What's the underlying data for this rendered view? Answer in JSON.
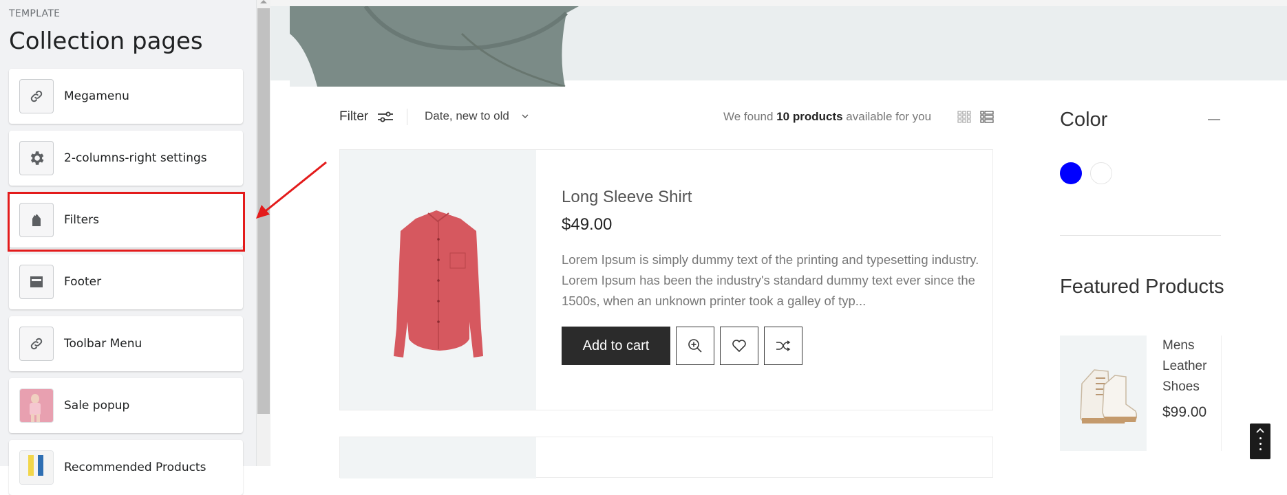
{
  "sidebar": {
    "eyebrow": "TEMPLATE",
    "title": "Collection pages",
    "items": [
      {
        "label": "Megamenu",
        "icon": "link-icon"
      },
      {
        "label": "2-columns-right settings",
        "icon": "gear-icon"
      },
      {
        "label": "Filters",
        "icon": "tag-icon"
      },
      {
        "label": "Footer",
        "icon": "footer-layout-icon"
      },
      {
        "label": "Toolbar Menu",
        "icon": "link-icon"
      },
      {
        "label": "Sale popup",
        "icon": "image-thumbnail"
      },
      {
        "label": "Recommended Products",
        "icon": "image-thumbnail"
      }
    ],
    "highlight_color": "#e31b1b"
  },
  "toolbar": {
    "filter_label": "Filter",
    "sort_label": "Date, new to old",
    "found_prefix": "We found",
    "found_count": "10 products",
    "found_suffix": "available for you"
  },
  "product": {
    "title": "Long Sleeve Shirt",
    "price": "$49.00",
    "description": "Lorem Ipsum is simply dummy text of the printing and typesetting industry. Lorem Ipsum has been the industry's standard dummy text ever since the 1500s, when an unknown printer took a galley of typ...",
    "add_to_cart": "Add to cart"
  },
  "color_filter": {
    "title": "Color",
    "swatches": [
      "#0000ff",
      "#ffffff"
    ]
  },
  "featured": {
    "title": "Featured Products",
    "item_name": "Mens Leather Shoes",
    "item_price": "$99.00"
  },
  "colors": {
    "accent_dark": "#2b2b2b",
    "annotation_red": "#e31b1b"
  }
}
